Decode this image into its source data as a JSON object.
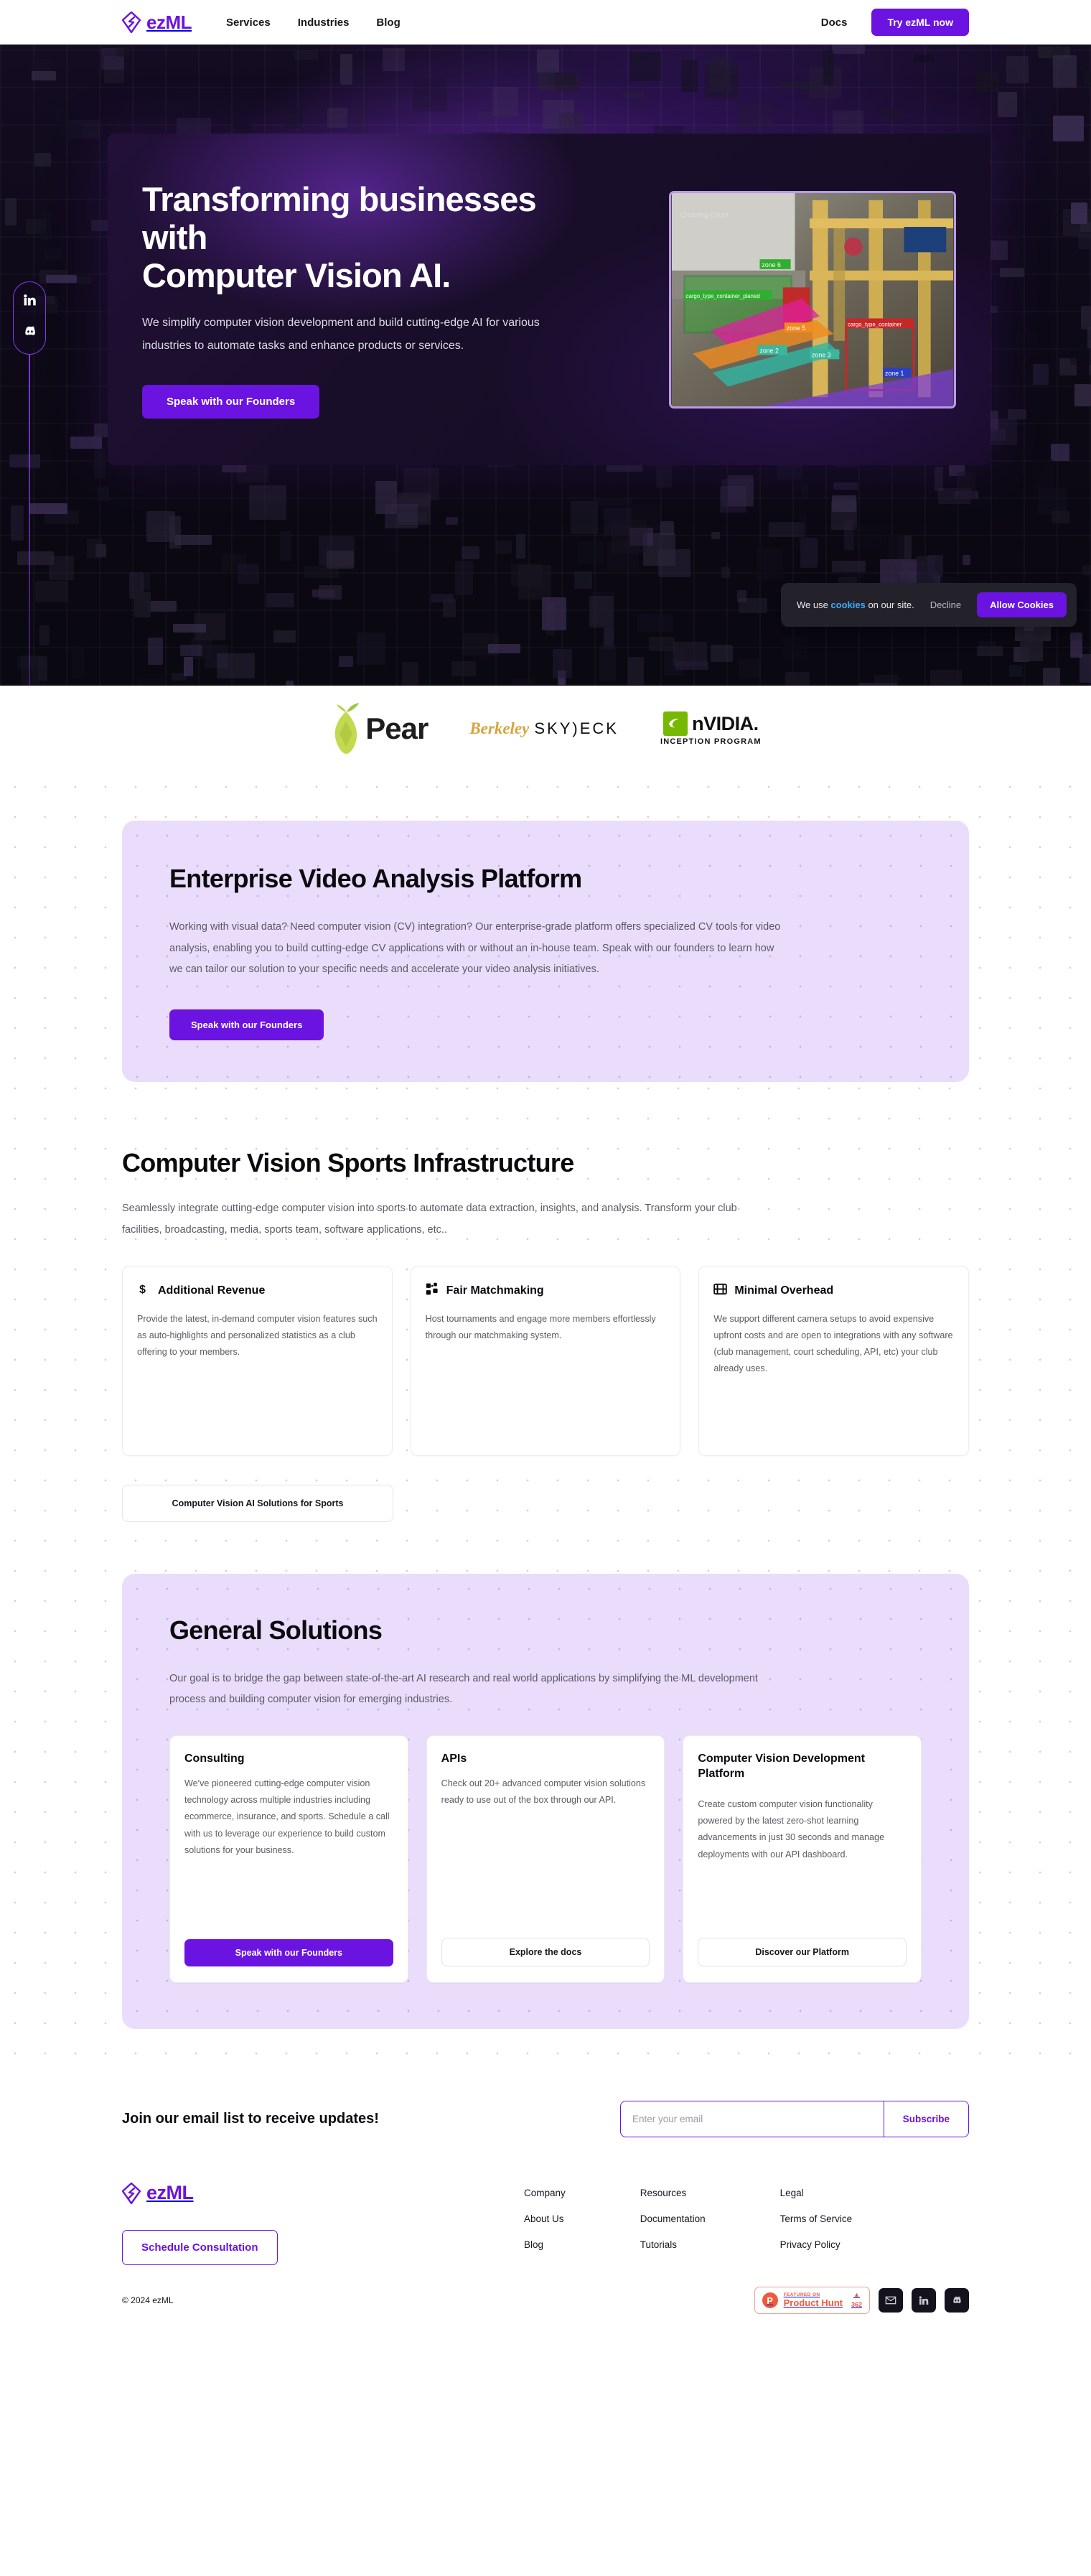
{
  "header": {
    "brand": "ezML",
    "nav": [
      {
        "label": "Services"
      },
      {
        "label": "Industries"
      },
      {
        "label": "Blog"
      }
    ],
    "docs_label": "Docs",
    "cta_label": "Try ezML now"
  },
  "hero": {
    "title_line1": "Transforming businesses with",
    "title_line2": "Computer Vision AI.",
    "subtitle": "We simplify computer vision development and build cutting-edge AI for various industries to automate tasks and enhance products or services.",
    "cta_label": "Speak with our Founders",
    "image_labels": {
      "counter": "Crossing Count",
      "zone6": "zone 6",
      "planned": "cargo_type_container_planed",
      "zone5": "zone 5",
      "zone2": "zone 2",
      "zone3": "zone 3",
      "container": "cargo_type_container",
      "zone1": "zone 1"
    },
    "social": [
      {
        "name": "linkedin"
      },
      {
        "name": "discord"
      }
    ]
  },
  "cookie": {
    "text_pre": "We use ",
    "text_link": "cookies",
    "text_post": " on our site.",
    "decline_label": "Decline",
    "allow_label": "Allow Cookies"
  },
  "logos": {
    "pear": "Pear",
    "berkeley": "Berkeley",
    "skydeck": "SKY)ECK",
    "nvidia": "nVIDIA.",
    "nvidia_sub": "INCEPTION PROGRAM"
  },
  "enterprise": {
    "title": "Enterprise Video Analysis Platform",
    "body": "Working with visual data? Need computer vision (CV) integration? Our enterprise-grade platform offers specialized CV tools for video analysis, enabling you to build cutting-edge CV applications with or without an in-house team. Speak with our founders to learn how we can tailor our solution to your specific needs and accelerate your video analysis initiatives.",
    "cta_label": "Speak with our Founders"
  },
  "sports": {
    "title": "Computer Vision Sports Infrastructure",
    "body": "Seamlessly integrate cutting-edge computer vision into sports to automate data extraction, insights, and analysis. Transform your club facilities, broadcasting, media, sports team, software applications, etc..",
    "cards": [
      {
        "icon": "dollar-icon",
        "title": "Additional Revenue",
        "body": "Provide the latest, in-demand computer vision features such as auto-highlights and personalized statistics as a club offering to your members."
      },
      {
        "icon": "matchmaking-icon",
        "title": "Fair Matchmaking",
        "body": "Host tournaments and engage more members effortlessly through our matchmaking system."
      },
      {
        "icon": "film-icon",
        "title": "Minimal Overhead",
        "body": "We support different camera setups to avoid expensive upfront costs and are open to integrations with any software (club management, court scheduling, API, etc) your club already uses."
      }
    ],
    "cta_label": "Computer Vision AI Solutions for Sports"
  },
  "general": {
    "title": "General Solutions",
    "body": "Our goal is to bridge the gap between state-of-the-art AI research and real world applications by simplifying the ML development process and building computer vision for emerging industries.",
    "cards": [
      {
        "title": "Consulting",
        "body": "We've pioneered cutting-edge computer vision technology across multiple industries including ecommerce, insurance, and sports. Schedule a call with us to leverage our experience to build custom solutions for your business.",
        "cta_label": "Speak with our Founders",
        "cta_style": "solid"
      },
      {
        "title": "APIs",
        "body": "Check out 20+ advanced computer vision solutions ready to use out of the box through our API.",
        "cta_label": "Explore the docs",
        "cta_style": "outline"
      },
      {
        "title": "Computer Vision Development Platform",
        "body": "Create custom computer vision functionality powered by the latest zero-shot learning advancements in just 30 seconds and manage deployments with our API dashboard.",
        "cta_label": "Discover our Platform",
        "cta_style": "outline"
      }
    ]
  },
  "newsletter": {
    "title": "Join our email list to receive updates!",
    "placeholder": "Enter your email",
    "value": "",
    "button_label": "Subscribe"
  },
  "footer": {
    "brand": "ezML",
    "consult_label": "Schedule Consultation",
    "columns": [
      {
        "heading": "Company",
        "links": [
          {
            "label": "About Us"
          },
          {
            "label": "Blog"
          }
        ]
      },
      {
        "heading": "Resources",
        "links": [
          {
            "label": "Documentation"
          },
          {
            "label": "Tutorials"
          }
        ]
      },
      {
        "heading": "Legal",
        "links": [
          {
            "label": "Terms of Service"
          },
          {
            "label": "Privacy Policy"
          }
        ]
      }
    ],
    "copyright": "© 2024 ezML",
    "product_hunt": {
      "featured": "FEATURED ON",
      "name": "Product Hunt",
      "votes": "362"
    },
    "social": [
      {
        "name": "email-icon"
      },
      {
        "name": "linkedin-icon"
      },
      {
        "name": "discord-icon"
      }
    ]
  },
  "colors": {
    "brand_purple": "#6b13e0",
    "panel_purple": "#eadcfb",
    "cookie_link": "#3fa9f5",
    "nvidia_green": "#76b900",
    "product_hunt_red": "#ef5a3c"
  }
}
